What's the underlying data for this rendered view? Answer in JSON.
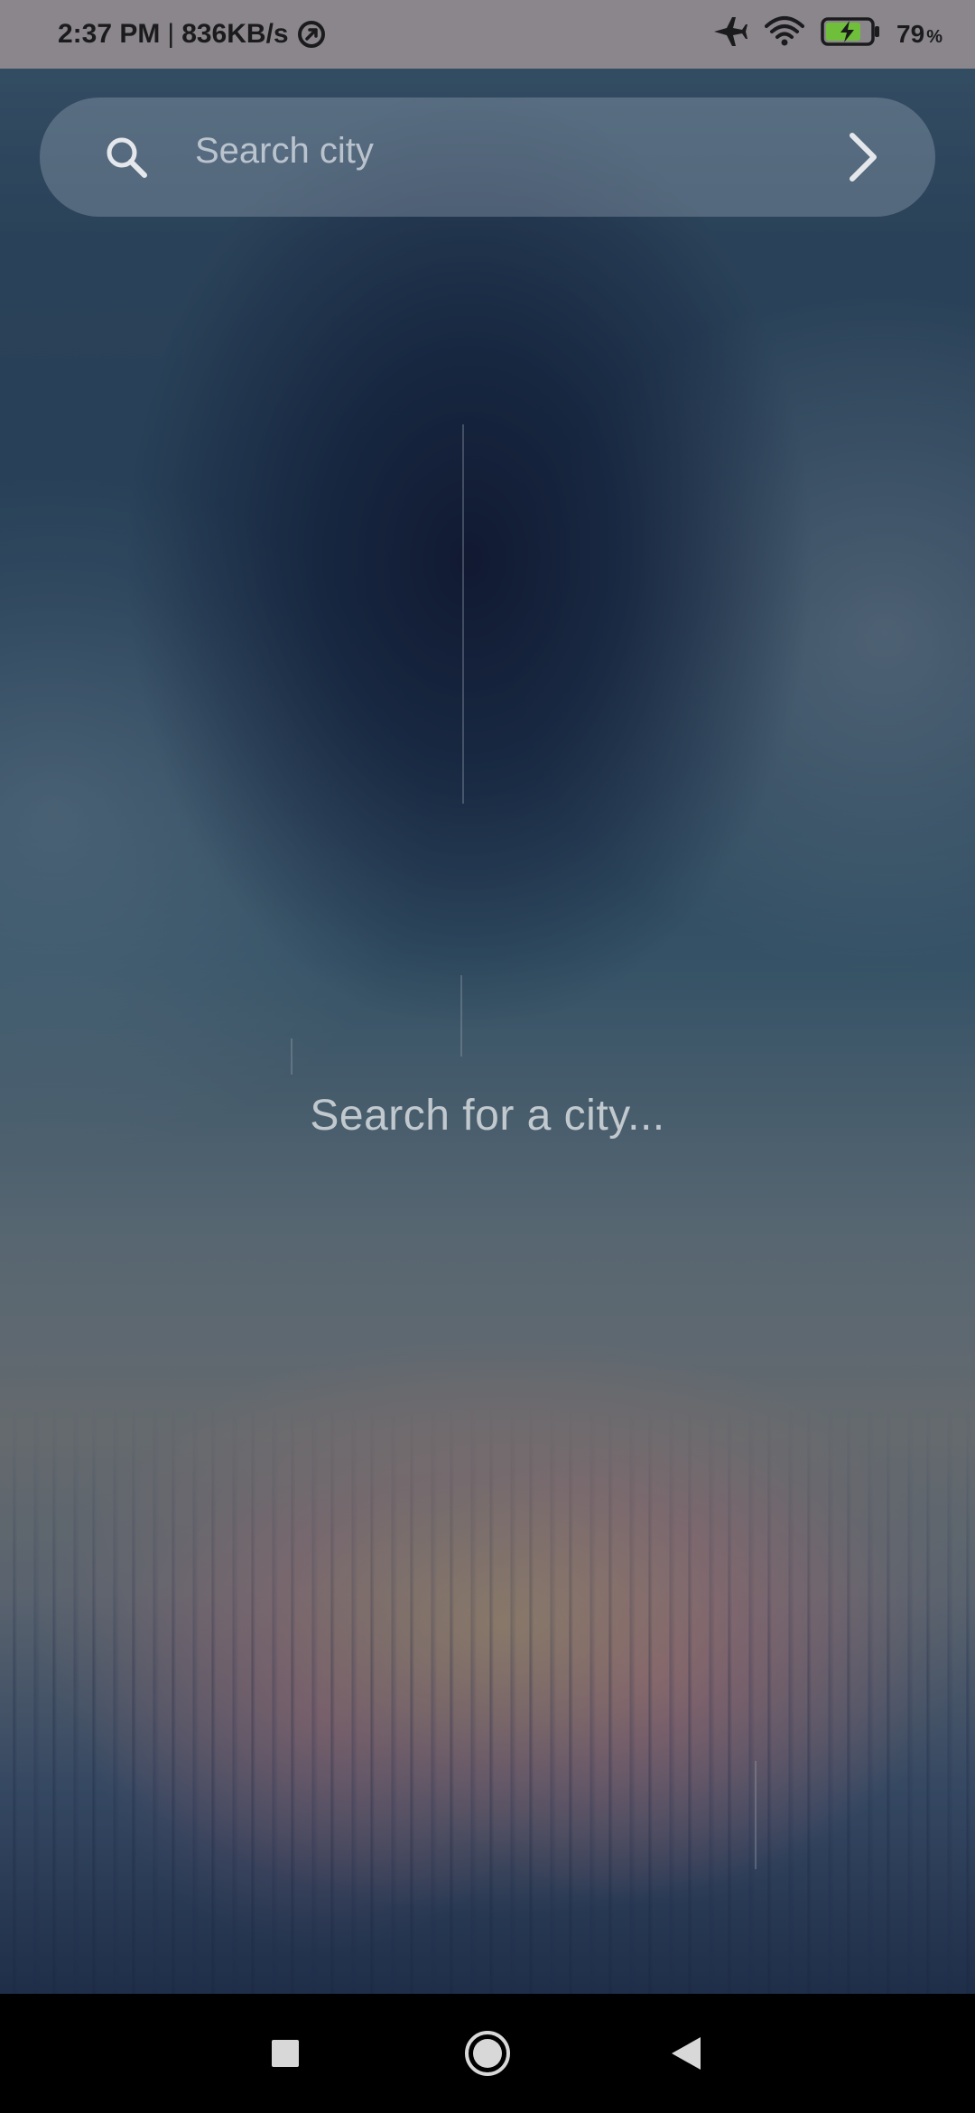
{
  "status_bar": {
    "time": "2:37 PM",
    "separator": "|",
    "network_speed": "836KB/s",
    "battery_percent": "79",
    "battery_percent_sign": "%",
    "icons": [
      "data-saver-icon",
      "airplane-mode-icon",
      "wifi-icon",
      "battery-charging-icon"
    ]
  },
  "search": {
    "placeholder": "Search city",
    "value": "",
    "icon": "search-icon",
    "submit_icon": "chevron-right-icon"
  },
  "main": {
    "empty_message": "Search for a city..."
  },
  "nav_bar": {
    "icons": [
      "recents-square-icon",
      "home-circle-icon",
      "back-triangle-icon"
    ]
  },
  "colors": {
    "status_bar_bg": "#8a868b",
    "nav_bar_bg": "#000000",
    "battery_fill": "#6fbf3a",
    "text_light": "#dce0e4"
  }
}
